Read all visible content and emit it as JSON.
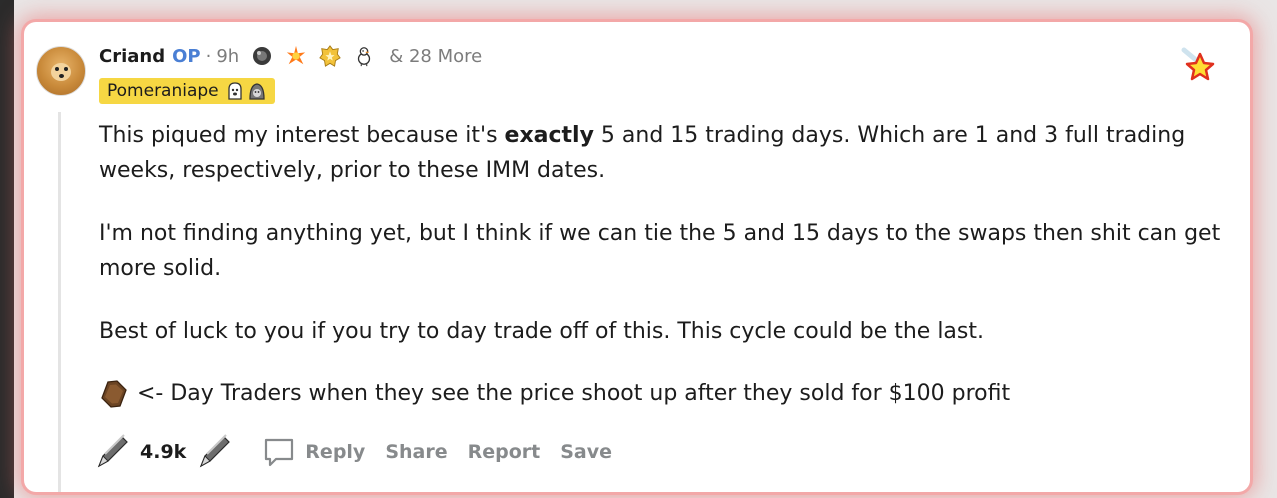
{
  "comment": {
    "author": "Criand",
    "op_badge": "OP",
    "separator": "·",
    "time": "9h",
    "more_awards": "& 28 More",
    "flair": "Pomeraniape",
    "body": {
      "p1": "This piqued my interest because it's ",
      "p1_bold": "exactly",
      "p1_rest": " 5 and 15 trading days. Which are 1 and 3 full trading weeks, respectively, prior to these IMM dates.",
      "p2_line1": "I'm not finding anything yet, but I think if we can tie the 5 and 15 days to the swaps then shit can get",
      "p2_line2": "more solid.",
      "p3": "Best of luck to you if you try to day trade off of this. This cycle could be the last.",
      "p4": "<- Day Traders when they see the price shoot up after they sold for $100 profit"
    },
    "score": "4.9k",
    "actions": {
      "reply": "Reply",
      "share": "Share",
      "report": "Report",
      "save": "Save"
    }
  },
  "icons": [
    "avatar",
    "award-icon",
    "flair-emoji-icon",
    "star-icon",
    "coffin-icon",
    "upvote-icon",
    "downvote-icon",
    "comment-icon"
  ],
  "colors": {
    "op": "#4a7fd4",
    "flair_bg": "#f6d743",
    "action_text": "#878a8c",
    "highlight_glow": "#f3a8a8"
  }
}
